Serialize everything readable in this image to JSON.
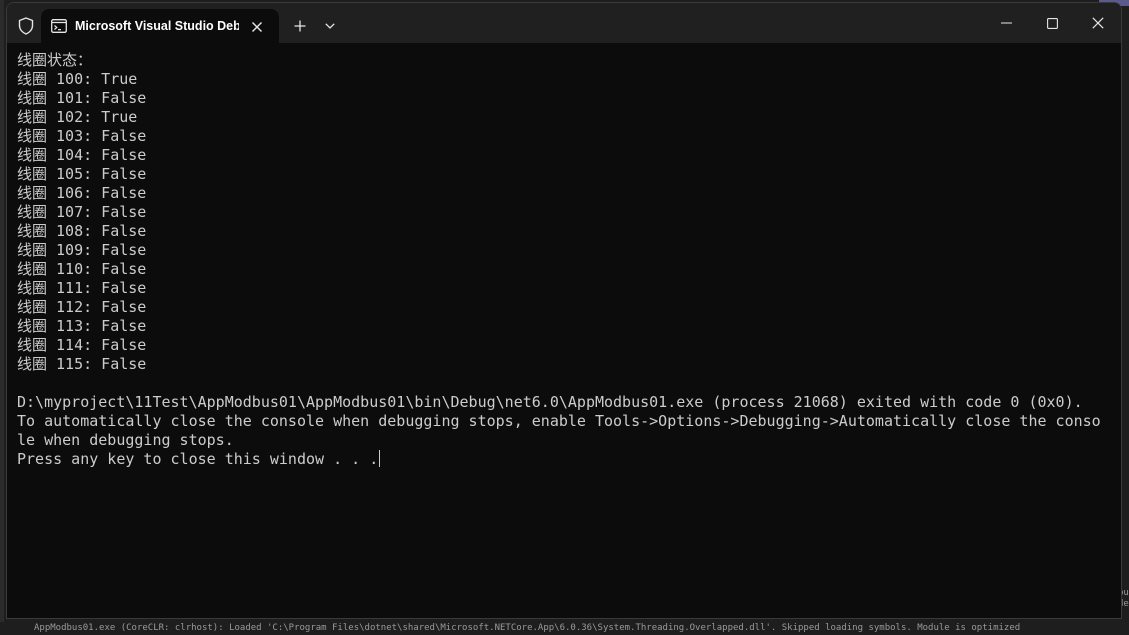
{
  "window": {
    "tab_title": "Microsoft Visual Studio Debug",
    "tab_icon": "terminal-icon",
    "new_tab_icon": "plus-icon",
    "dropdown_icon": "chevron-down-icon"
  },
  "console": {
    "header": "线圈状态：",
    "coils": [
      "线圈 100: True",
      "线圈 101: False",
      "线圈 102: True",
      "线圈 103: False",
      "线圈 104: False",
      "线圈 105: False",
      "线圈 106: False",
      "线圈 107: False",
      "线圈 108: False",
      "线圈 109: False",
      "线圈 110: False",
      "线圈 111: False",
      "线圈 112: False",
      "线圈 113: False",
      "线圈 114: False",
      "线圈 115: False"
    ],
    "blank": "",
    "exit_message": "D:\\myproject\\11Test\\AppModbus01\\AppModbus01\\bin\\Debug\\net6.0\\AppModbus01.exe (process 21068) exited with code 0 (0x0).",
    "auto_close_line1": "To automatically close the console when debugging stops, enable Tools->Options->Debugging->Automatically close the conso",
    "auto_close_line2": "le when debugging stops.",
    "press_key": "Press any key to close this window . . ."
  },
  "backdrop": {
    "bottom_text": "AppModbus01.exe (CoreCLR: clrhost): Loaded 'C:\\Program Files\\dotnet\\shared\\Microsoft.NETCore.App\\6.0.36\\System.Threading.Overlapped.dll'. Skipped loading symbols. Module is optimized",
    "right_text_1": "bu",
    "right_text_2": "de"
  },
  "colors": {
    "console_bg": "#0c0c0c",
    "console_fg": "#cccccc",
    "titlebar_bg": "#202020"
  }
}
